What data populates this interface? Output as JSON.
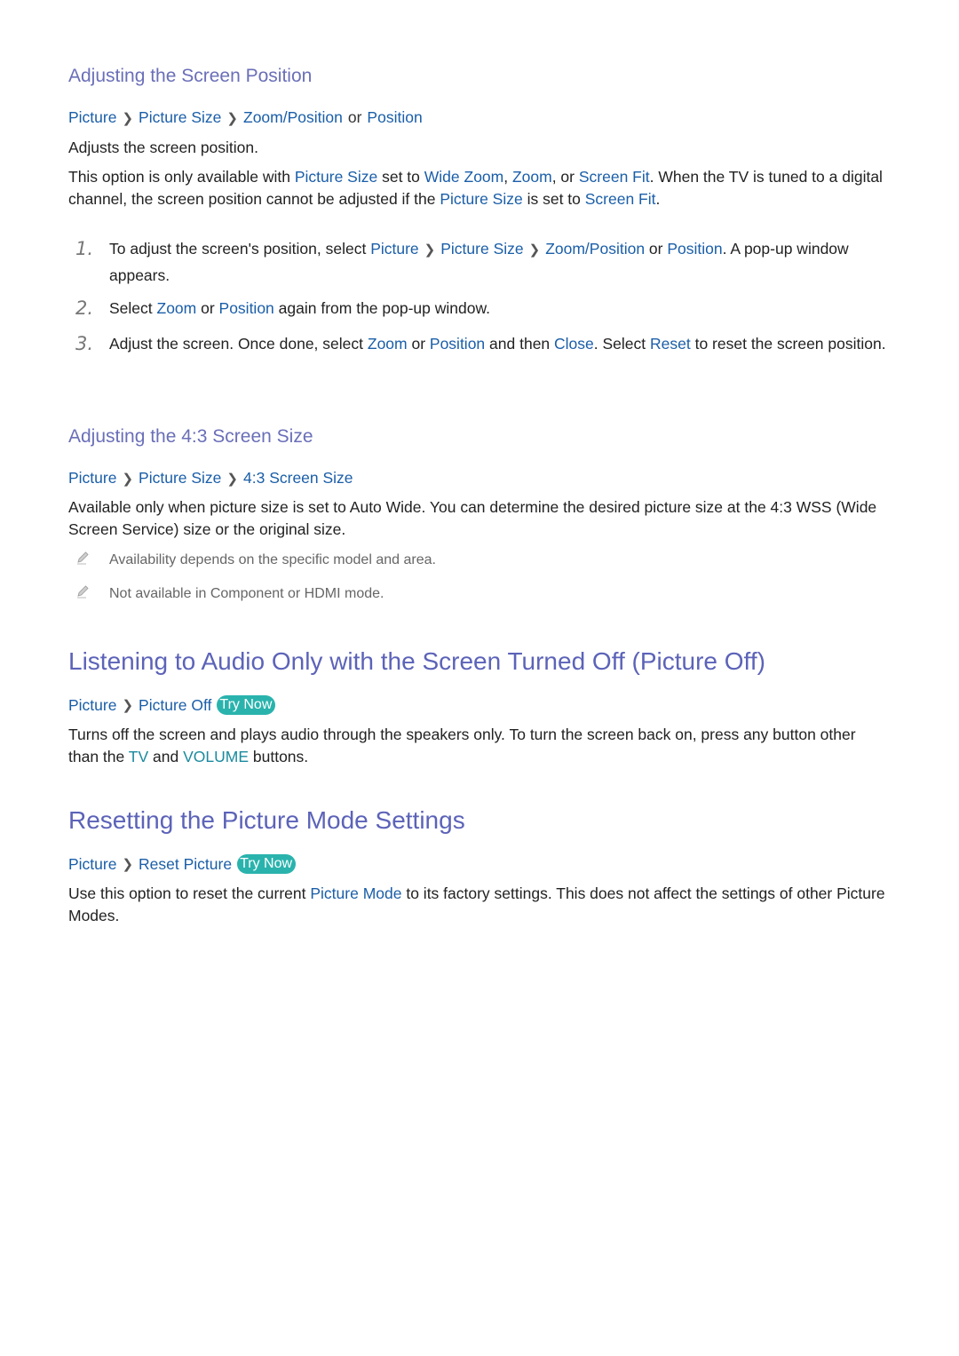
{
  "sections": {
    "screen_position": {
      "heading": "Adjusting the Screen Position",
      "path": [
        "Picture",
        "Picture Size",
        "Zoom/Position"
      ],
      "path_or": "or",
      "path_alt": "Position",
      "intro": "Adjusts the screen position.",
      "para": {
        "t1": "This option is only available with ",
        "l1": "Picture Size",
        "t2": " set to ",
        "l2": "Wide Zoom",
        "t3": ", ",
        "l3": "Zoom",
        "t4": ", or ",
        "l4": "Screen Fit",
        "t5": ". When the TV is tuned to a digital channel, the screen position cannot be adjusted if the ",
        "l5": "Picture Size",
        "t6": " is set to ",
        "l6": "Screen Fit",
        "t7": "."
      },
      "steps": [
        {
          "num": "1.",
          "t1": "To adjust the screen's position, select ",
          "l1": "Picture",
          "l2": "Picture Size",
          "l3": "Zoom/Position",
          "t2": " or ",
          "l4": "Position",
          "t3": ". A pop-up window appears."
        },
        {
          "num": "2.",
          "t1": "Select ",
          "l1": "Zoom",
          "t2": " or ",
          "l2": "Position",
          "t3": " again from the pop-up window."
        },
        {
          "num": "3.",
          "t1": "Adjust the screen. Once done, select ",
          "l1": "Zoom",
          "t2": " or ",
          "l2": "Position",
          "t3": " and then ",
          "l3": "Close",
          "t4": ". Select ",
          "l4": "Reset",
          "t5": " to reset the screen position."
        }
      ]
    },
    "screen_size_43": {
      "heading": "Adjusting the 4:3 Screen Size",
      "path": [
        "Picture",
        "Picture Size",
        "4:3 Screen Size"
      ],
      "para": "Available only when picture size is set to Auto Wide. You can determine the desired picture size at the 4:3 WSS (Wide Screen Service) size or the original size.",
      "notes": [
        {
          "icon": "pencil-note-icon",
          "text": "Availability depends on the specific model and area."
        },
        {
          "icon": "pencil-note-icon",
          "text": "Not available in Component or HDMI mode."
        }
      ]
    },
    "picture_off": {
      "heading": "Listening to Audio Only with the Screen Turned Off (Picture Off)",
      "path": [
        "Picture",
        "Picture Off"
      ],
      "try_now": "Try Now",
      "para": {
        "t1": "Turns off the screen and plays audio through the speakers only. To turn the screen back on, press any button other than the ",
        "l1": "TV",
        "t2": " and ",
        "l2": "VOLUME",
        "t3": " buttons."
      }
    },
    "reset_picture": {
      "heading": "Resetting the Picture Mode Settings",
      "path": [
        "Picture",
        "Reset Picture"
      ],
      "try_now": "Try Now",
      "para": {
        "t1": "Use this option to reset the current ",
        "l1": "Picture Mode",
        "t2": " to its factory settings. This does not affect the settings of other Picture Modes."
      }
    }
  },
  "colors": {
    "heading": "#5c63b8",
    "subheading": "#6a6fb8",
    "link": "#1a5ea8",
    "button_text": "#1a8a9e",
    "try_now_bg": "#2ab3ad"
  }
}
